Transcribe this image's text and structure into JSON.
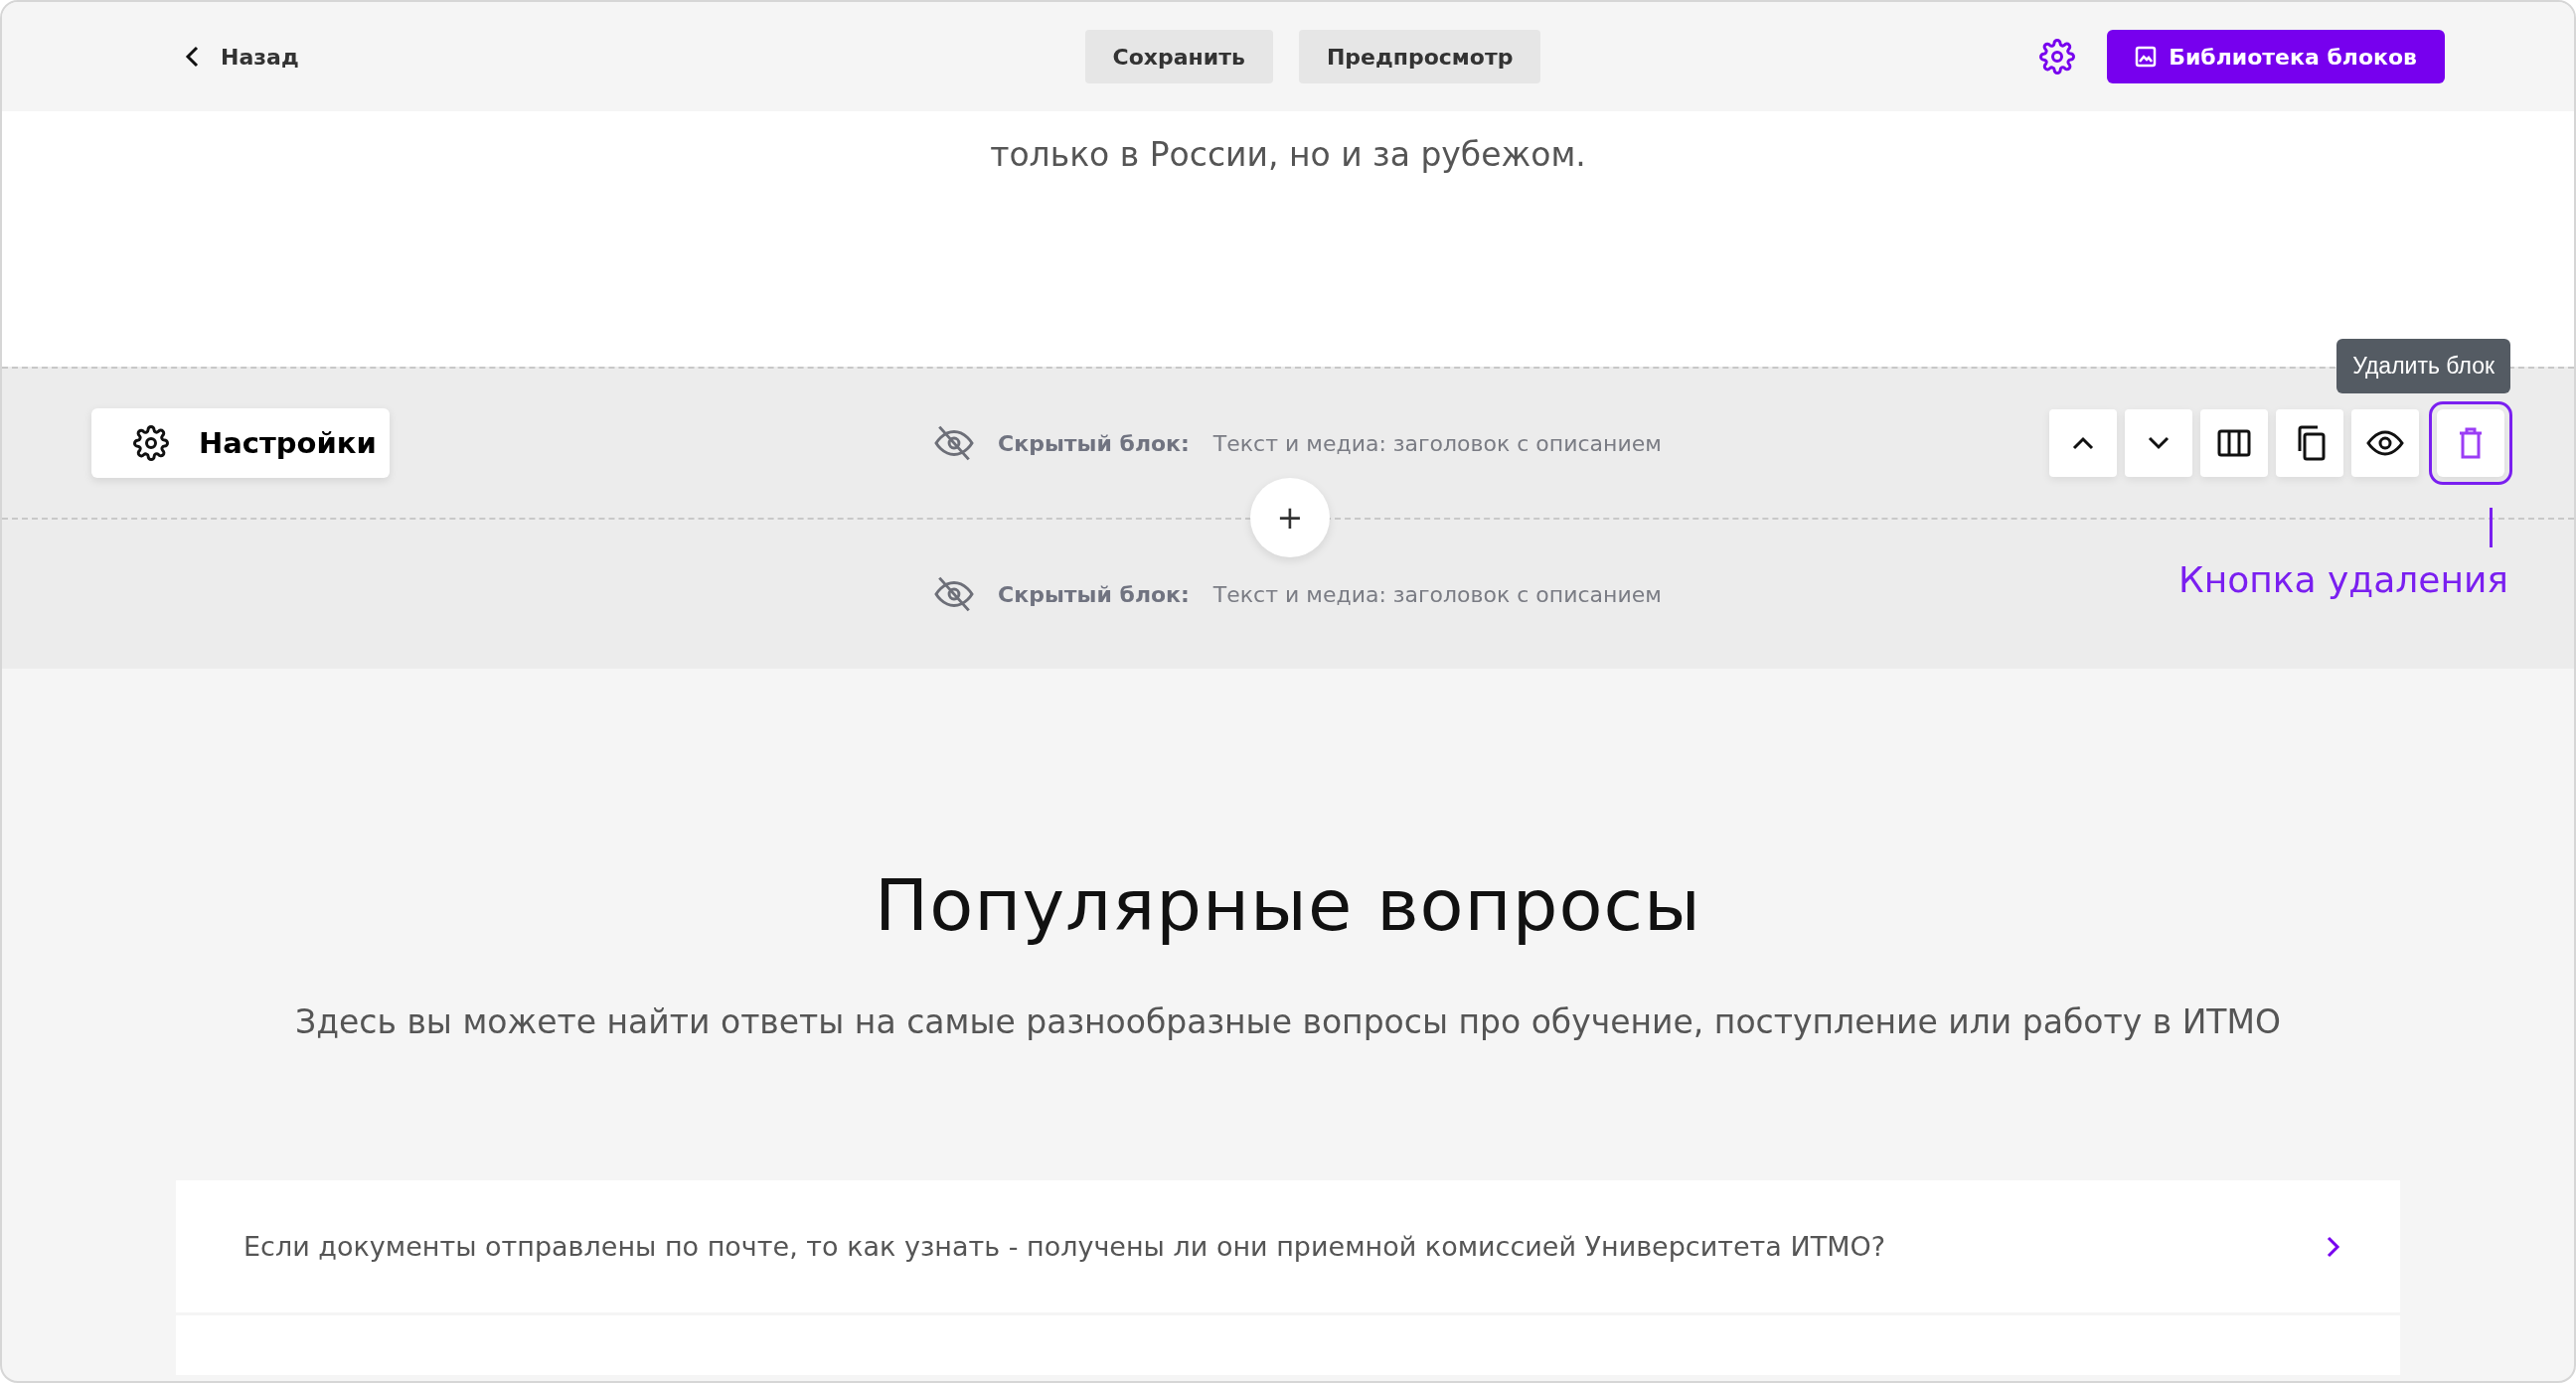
{
  "header": {
    "back": "Назад",
    "buttons": [
      "Сохранить",
      "Предпросмотр"
    ],
    "library_button": "Библиотека блоков"
  },
  "intro_text": "только в России, но и за рубежом.",
  "block_toolbar": {
    "settings_button": "Настройки",
    "tools": [
      {
        "kind": "up",
        "highlighted": false
      },
      {
        "kind": "down",
        "highlighted": false
      },
      {
        "kind": "columns",
        "highlighted": false
      },
      {
        "kind": "copy",
        "highlighted": false
      },
      {
        "kind": "visibility",
        "highlighted": false
      },
      {
        "kind": "delete",
        "highlighted": true
      }
    ],
    "tooltip": "Удалить блок",
    "add_button": "+",
    "annotation": "Кнопка удаления"
  },
  "hidden_blocks": [
    {
      "label": "Скрытый блок:",
      "name": "Текст и медиа: заголовок с описанием"
    },
    {
      "label": "Скрытый блок:",
      "name": "Текст и медиа: заголовок с описанием"
    }
  ],
  "faq": {
    "title": "Популярные вопросы",
    "subtitle": "Здесь вы можете найти ответы на самые разнообразные вопросы про обучение, поступление или работу в ИТМО",
    "questions": [
      "Если документы отправлены по почте, то как узнать - получены ли они приемной комиссией Университета ИТМО?"
    ]
  }
}
